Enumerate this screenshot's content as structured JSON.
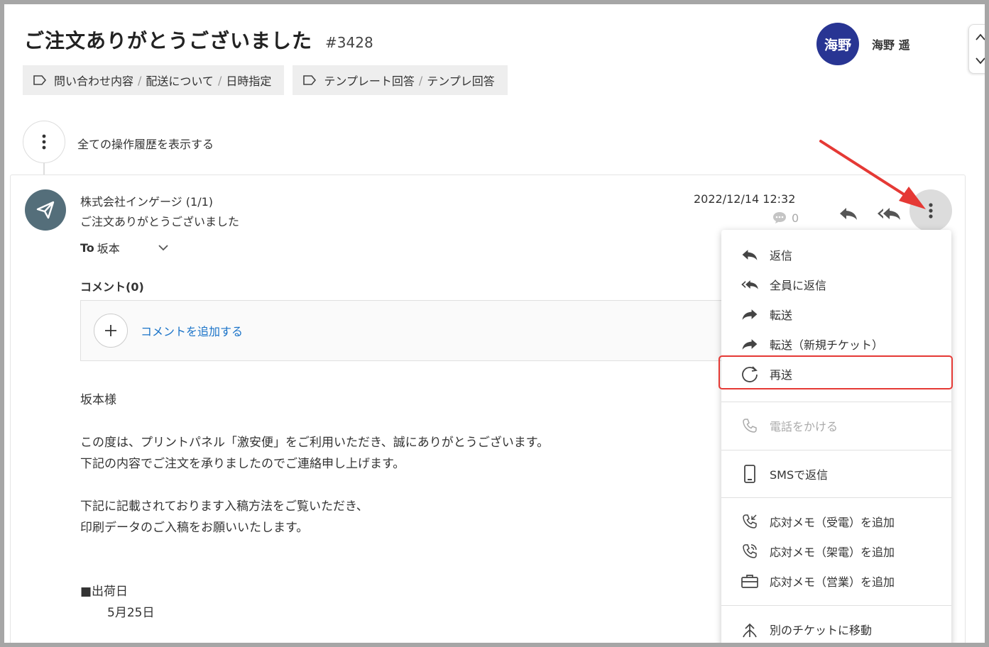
{
  "header": {
    "title": "ご注文ありがとうございました",
    "ticket_no": "#3428",
    "tags": [
      {
        "parts": [
          "問い合わせ内容",
          "配送について",
          "日時指定"
        ]
      },
      {
        "parts": [
          "テンプレート回答",
          "テンプレ回答"
        ]
      }
    ],
    "user": {
      "avatar_text": "海野",
      "name": "海野 遥"
    }
  },
  "history": {
    "label": "全ての操作履歴を表示する"
  },
  "message": {
    "sender": "株式会社インゲージ (1/1)",
    "subject": "ご注文ありがとうございました",
    "to_label": "To",
    "to_name": "坂本",
    "date": "2022/12/14 12:32",
    "comment_count": "0",
    "comments_title": "コメント(0)",
    "add_comment": "コメントを追加する",
    "body": {
      "greeting": "坂本様",
      "para1_line1": "この度は、プリントパネル「激安便」をご利用いただき、誠にありがとうございます。",
      "para1_line2": "下記の内容でご注文を承りましたのでご連絡申し上げます。",
      "para2_line1": "下記に記載されております入稿方法をご覧いただき、",
      "para2_line2": "印刷データのご入稿をお願いいたします。",
      "ship_heading": "■出荷日",
      "ship_date": "5月25日"
    }
  },
  "menu": {
    "reply": "返信",
    "reply_all": "全員に返信",
    "forward": "転送",
    "forward_new": "転送（新規チケット）",
    "resend": "再送",
    "call": "電話をかける",
    "sms": "SMSで返信",
    "memo_in": "応対メモ（受電）を追加",
    "memo_out": "応対メモ（架電）を追加",
    "memo_sales": "応対メモ（営業）を追加",
    "move": "別のチケットに移動"
  },
  "colors": {
    "avatar": "#283593",
    "sender_icon": "#546e7a",
    "link": "#1a73c8",
    "annotation": "#e53935"
  }
}
